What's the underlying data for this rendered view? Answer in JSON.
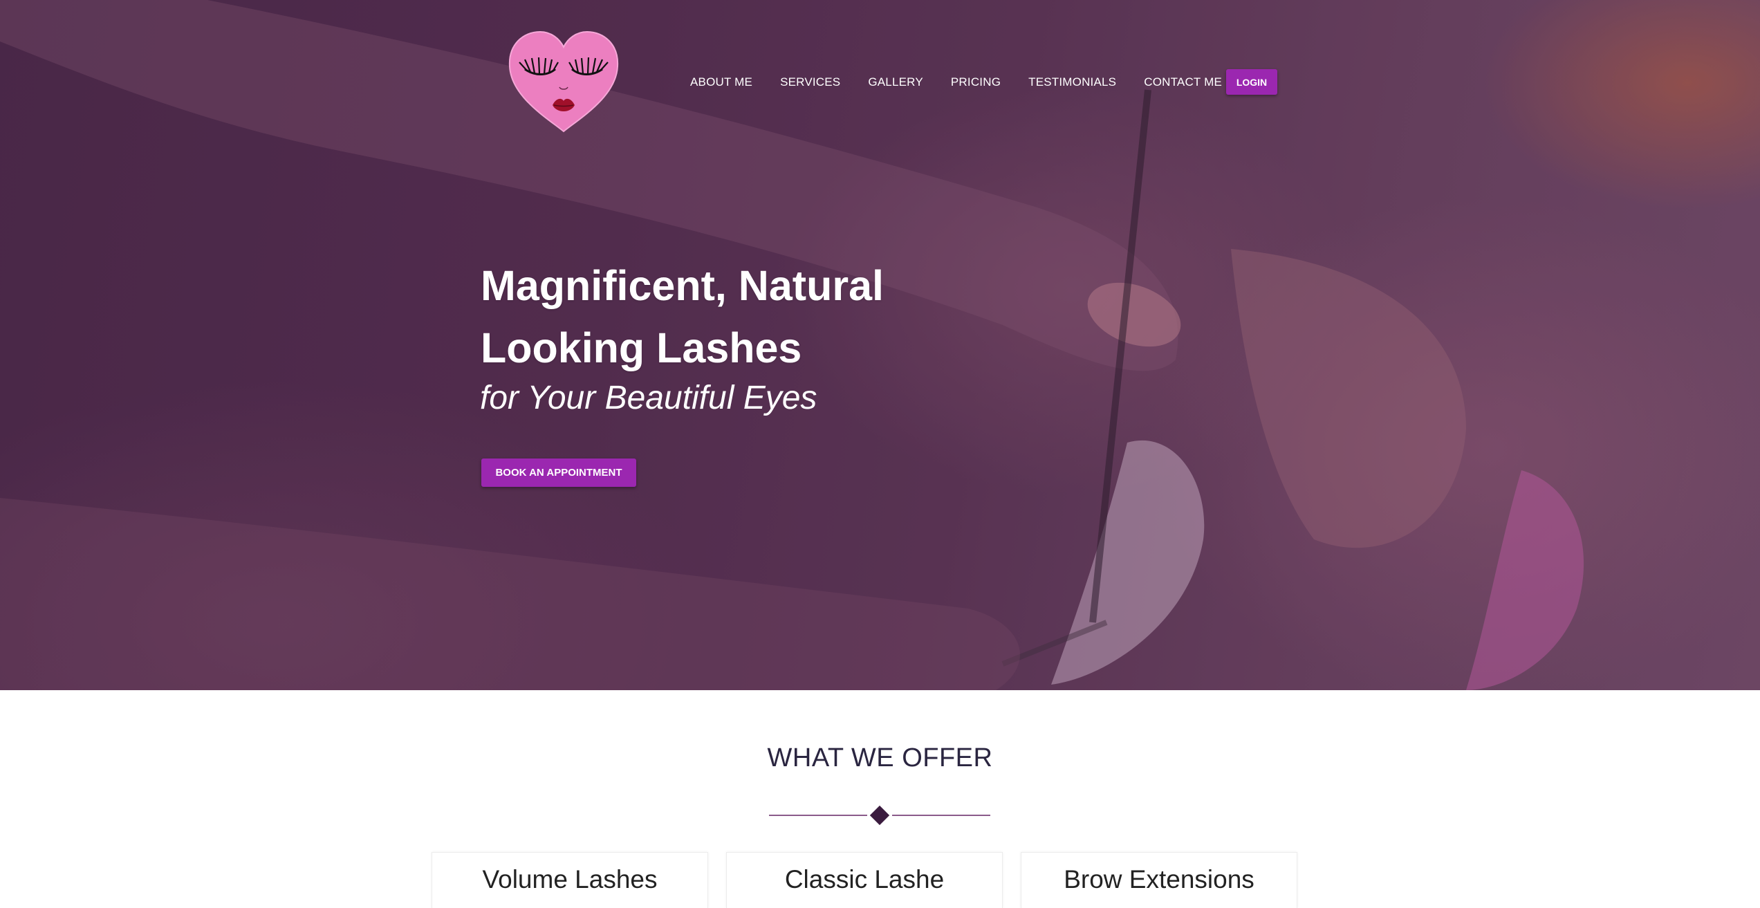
{
  "nav": {
    "items": [
      {
        "label": "ABOUT ME"
      },
      {
        "label": "SERVICES"
      },
      {
        "label": "GALLERY"
      },
      {
        "label": "PRICING"
      },
      {
        "label": "TESTIMONIALS"
      },
      {
        "label": "CONTACT ME"
      }
    ],
    "login_label": "LOGIN"
  },
  "hero": {
    "headline_line1": "Magnificent, Natural",
    "headline_line2": "Looking Lashes",
    "subheadline": "for Your Beautiful Eyes",
    "cta_label": "BOOK AN APPOINTMENT"
  },
  "offer": {
    "title": "WHAT WE OFFER",
    "cards": [
      {
        "title": "Volume Lashes"
      },
      {
        "title": "Classic Lashe"
      },
      {
        "title": "Brow Extensions"
      }
    ]
  },
  "colors": {
    "accent": "#9b27b0",
    "hero_overlay": "#4a2a48",
    "logo_pink": "#ec7fc0",
    "divider": "#8a5a8a",
    "diamond": "#3a1b3e"
  },
  "icons": {
    "logo": "heart-face-logo-icon",
    "divider": "diamond-icon"
  }
}
